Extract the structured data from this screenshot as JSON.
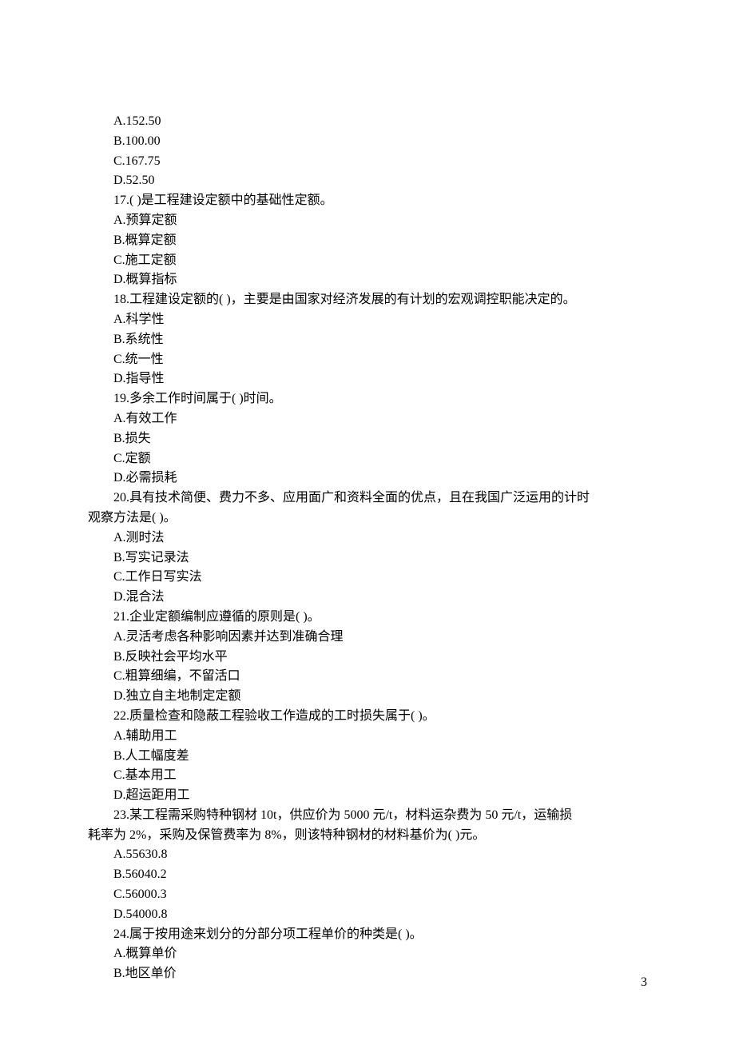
{
  "page_number": "3",
  "prev_tail": {
    "opts": [
      "A.152.50",
      "B.100.00",
      "C.167.75",
      "D.52.50"
    ]
  },
  "q17": {
    "stem": "17.( )是工程建设定额中的基础性定额。",
    "opts": [
      "A.预算定额",
      "B.概算定额",
      "C.施工定额",
      "D.概算指标"
    ]
  },
  "q18": {
    "stem": "18.工程建设定额的( )，主要是由国家对经济发展的有计划的宏观调控职能决定的。",
    "opts": [
      "A.科学性",
      "B.系统性",
      "C.统一性",
      "D.指导性"
    ]
  },
  "q19": {
    "stem": "19.多余工作时间属于( )时间。",
    "opts": [
      "A.有效工作",
      "B.损失",
      "C.定额",
      "D.必需损耗"
    ]
  },
  "q20": {
    "stem_line1": "20.具有技术简便、费力不多、应用面广和资料全面的优点，且在我国广泛运用的计时",
    "stem_line2": "观察方法是( )。",
    "opts": [
      "A.测时法",
      "B.写实记录法",
      "C.工作日写实法",
      "D.混合法"
    ]
  },
  "q21": {
    "stem": "21.企业定额编制应遵循的原则是( )。",
    "opts": [
      "A.灵活考虑各种影响因素并达到准确合理",
      "B.反映社会平均水平",
      "C.粗算细编，不留活口",
      "D.独立自主地制定定额"
    ]
  },
  "q22": {
    "stem": "22.质量检查和隐蔽工程验收工作造成的工时损失属于( )。",
    "opts": [
      "A.辅助用工",
      "B.人工幅度差",
      "C.基本用工",
      "D.超运距用工"
    ]
  },
  "q23": {
    "stem_line1": "23.某工程需采购特种钢材 10t，供应价为 5000 元/t，材料运杂费为 50 元/t，运输损",
    "stem_line2": "耗率为 2%，采购及保管费率为 8%，则该特种钢材的材料基价为( )元。",
    "opts": [
      "A.55630.8",
      "B.56040.2",
      "C.56000.3",
      "D.54000.8"
    ]
  },
  "q24": {
    "stem": "24.属于按用途来划分的分部分项工程单价的种类是( )。",
    "opts": [
      "A.概算单价",
      "B.地区单价"
    ]
  }
}
